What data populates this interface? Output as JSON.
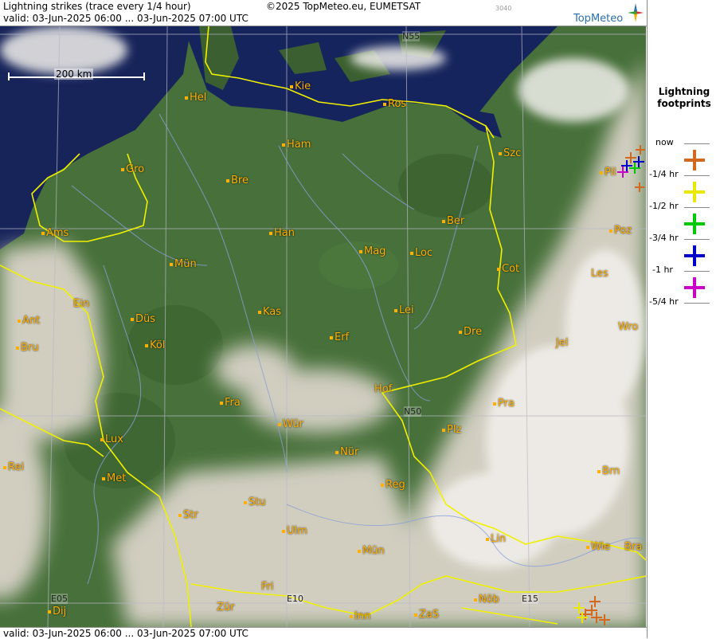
{
  "header": {
    "title": "Lightning strikes (trace every 1/4 hour)",
    "valid": "valid:  03-Jun-2025 06:00 ... 03-Jun-2025 07:00 UTC",
    "copyright": "©2025 TopMeteo.eu, EUMETSAT",
    "code": "3040",
    "logo_text": "TopMeteo"
  },
  "footer": {
    "valid": "valid:  03-Jun-2025 06:00 ... 03-Jun-2025 07:00 UTC"
  },
  "map": {
    "scale_label": "200 km",
    "grid_labels": [
      "N55",
      "N50",
      "E05",
      "E10",
      "E15"
    ],
    "cities": [
      "Hel",
      "Kie",
      "Ros",
      "Ham",
      "Szc",
      "Gro",
      "Bre",
      "Pil",
      "Ber",
      "Ams",
      "Han",
      "Mag",
      "Loc",
      "Poz",
      "Mün",
      "Cot",
      "Les",
      "Ein",
      "Kas",
      "Lei",
      "Ant",
      "Düs",
      "Erf",
      "Dre",
      "Wro",
      "Bru",
      "Köl",
      "Jel",
      "Hof",
      "Fra",
      "N50",
      "Pra",
      "Würzburg",
      "Plz",
      "Lux",
      "Nür",
      "Rei",
      "Met",
      "Brn",
      "Reg",
      "Stu",
      "Str",
      "Ulm",
      "Lin",
      "Wie",
      "Bra",
      "Mün",
      "Fri",
      "Dij",
      "Zür",
      "Inn",
      "ZaS",
      "Nöb"
    ]
  },
  "cities": [
    {
      "name": "Hel"
    },
    {
      "name": "Kie"
    },
    {
      "name": "Ros"
    },
    {
      "name": "Ham"
    },
    {
      "name": "Szc"
    },
    {
      "name": "Gro"
    },
    {
      "name": "Bre"
    },
    {
      "name": "Pil"
    },
    {
      "name": "Ber"
    },
    {
      "name": "Ams"
    },
    {
      "name": "Han"
    },
    {
      "name": "Mag"
    },
    {
      "name": "Loc"
    },
    {
      "name": "Poz"
    },
    {
      "name": "Mün"
    },
    {
      "name": "Cot"
    },
    {
      "name": "Les"
    },
    {
      "name": "Ein"
    },
    {
      "name": "Kas"
    },
    {
      "name": "Lei"
    },
    {
      "name": "Ant"
    },
    {
      "name": "Düs"
    },
    {
      "name": "Erf"
    },
    {
      "name": "Dre"
    },
    {
      "name": "Wro"
    },
    {
      "name": "Bru"
    },
    {
      "name": "Köl"
    },
    {
      "name": "Jel"
    },
    {
      "name": "Hof"
    },
    {
      "name": "Fra"
    },
    {
      "name": "Pra"
    },
    {
      "name": "Wür"
    },
    {
      "name": "Plz"
    },
    {
      "name": "Lux"
    },
    {
      "name": "Nür"
    },
    {
      "name": "Rei"
    },
    {
      "name": "Met"
    },
    {
      "name": "Brn"
    },
    {
      "name": "Reg"
    },
    {
      "name": "Stu"
    },
    {
      "name": "Str"
    },
    {
      "name": "Ulm"
    },
    {
      "name": "Lin"
    },
    {
      "name": "Wie"
    },
    {
      "name": "Bra"
    },
    {
      "name": "Mün"
    },
    {
      "name": "Fri"
    },
    {
      "name": "Dij"
    },
    {
      "name": "Zür"
    },
    {
      "name": "Inn"
    },
    {
      "name": "ZaS"
    },
    {
      "name": "Nöb"
    }
  ],
  "legend": {
    "title_line1": "Lightning",
    "title_line2": "footprints",
    "rows": [
      {
        "label": "now",
        "color": "#d2691e"
      },
      {
        "label": "-1/4 hr",
        "color": "#e8e800"
      },
      {
        "label": "-1/2 hr",
        "color": "#00c800"
      },
      {
        "label": "-3/4 hr",
        "color": "#0000c8"
      },
      {
        "label": "-1 hr",
        "color": "#c800c8"
      },
      {
        "label": "-5/4 hr",
        "color": ""
      }
    ]
  }
}
